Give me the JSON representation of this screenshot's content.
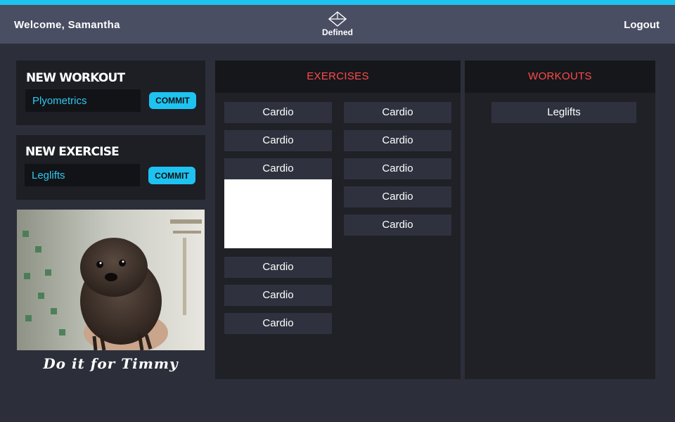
{
  "header": {
    "welcome": "Welcome, Samantha",
    "brand": "Defined",
    "logout": "Logout"
  },
  "new_workout": {
    "title": "NEW WORKOUT",
    "value": "Plyometrics",
    "button": "COMMIT"
  },
  "new_exercise": {
    "title": "NEW EXERCISE",
    "value": "Leglifts",
    "button": "COMMIT"
  },
  "photo": {
    "caption": "Do it for Timmy"
  },
  "exercises": {
    "title": "EXERCISES",
    "left": [
      "Cardio",
      "Cardio",
      "Cardio",
      "Cardio",
      "Cardio",
      "Cardio"
    ],
    "right": [
      "Cardio",
      "Cardio",
      "Cardio",
      "Cardio",
      "Cardio"
    ]
  },
  "workouts": {
    "title": "WORKOUTS",
    "items": [
      "Leglifts"
    ]
  },
  "colors": {
    "accent": "#1ec3f1",
    "header": "#4a4e63",
    "panel_title": "#ff4b4b"
  }
}
